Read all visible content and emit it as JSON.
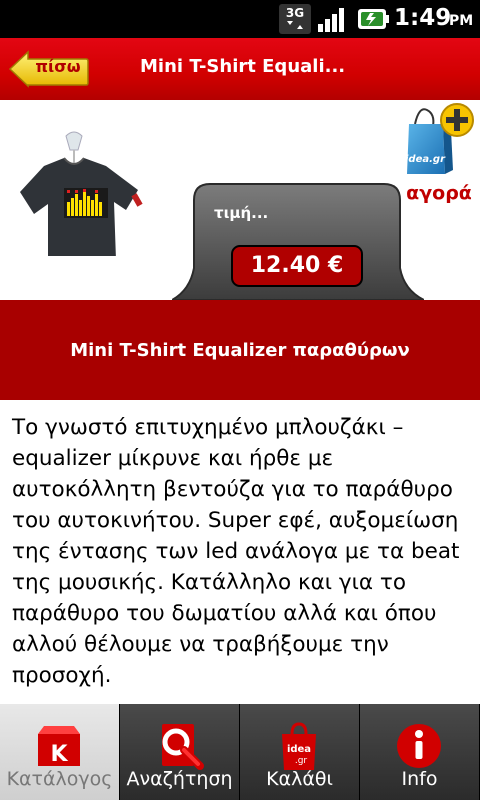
{
  "status_bar": {
    "network": "3G",
    "time": "1:49",
    "ampm": "PM"
  },
  "header": {
    "back_label": "πίσω",
    "title": "Mini T-Shirt Equali..."
  },
  "product": {
    "buy_label": "αγορά",
    "price_label": "τιμή...",
    "price": "12.40 €",
    "title": "Mini T-Shirt Equalizer παραθύρων",
    "description": "Το γνωστό επιτυχημένο μπλουζάκι – equalizer μίκρυνε και ήρθε με αυτοκόλλητη βεντούζα για το παράθυρο του αυτοκινήτου. Super εφέ, αυξομείωση της έντασης των led ανάλογα με τα beat της μουσικής. Κατάλληλο και για το παράθυρο του δωματίου αλλά και όπου αλλού θέλουμε να τραβήξουμε την προσοχή."
  },
  "tabs": [
    {
      "label": "Κατάλογος",
      "icon": "catalog-icon",
      "active": true
    },
    {
      "label": "Αναζήτηση",
      "icon": "search-icon",
      "active": false
    },
    {
      "label": "Καλάθι",
      "icon": "basket-icon",
      "active": false
    },
    {
      "label": "Info",
      "icon": "info-icon",
      "active": false
    }
  ],
  "bag_logo_text": "idea.gr",
  "colors": {
    "brand_red": "#d10000",
    "band_red": "#a80000",
    "price_red": "#b00000",
    "back_yellow": "#f2d200"
  }
}
